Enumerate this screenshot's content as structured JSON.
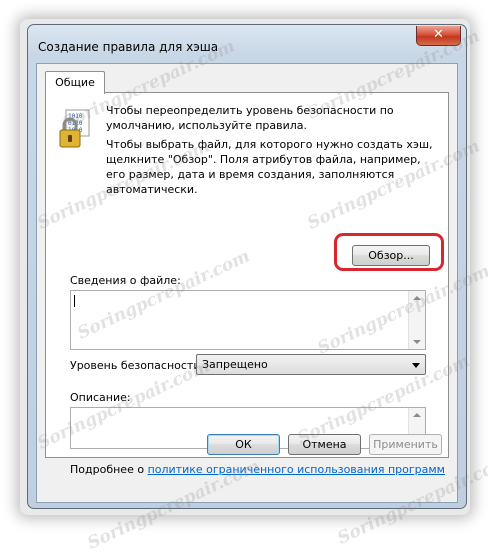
{
  "window": {
    "title": "Создание правила для хэша",
    "close_label": "✕"
  },
  "tabs": [
    {
      "label": "Общие",
      "active": true
    }
  ],
  "icons": {
    "main_icon": "lock-binary-icon",
    "close": "close-icon"
  },
  "description": {
    "line1": "Чтобы переопределить уровень безопасности по умолчанию, используйте правила.",
    "line2": "Чтобы выбрать файл, для которого нужно создать хэш, щелкните \"Обзор\". Поля атрибутов файла, например, его размер, дата и время создания, заполняются автоматически."
  },
  "browse_button": {
    "label": "Обзор..."
  },
  "file_info": {
    "label": "Сведения о файле:",
    "value": ""
  },
  "security_level": {
    "label": "Уровень безопасности:",
    "selected": "Запрещено"
  },
  "description_field": {
    "label": "Описание:",
    "value": ""
  },
  "more_info": {
    "prefix": "Подробнее о ",
    "link": "политике ограниченного использования программ"
  },
  "buttons": {
    "ok": "ОК",
    "cancel": "Отмена",
    "apply": "Применить"
  },
  "watermark": "Soringpcrepair.com",
  "colors": {
    "highlight": "#d7262d",
    "link": "#0066cc",
    "close_button": "#c0381d"
  }
}
